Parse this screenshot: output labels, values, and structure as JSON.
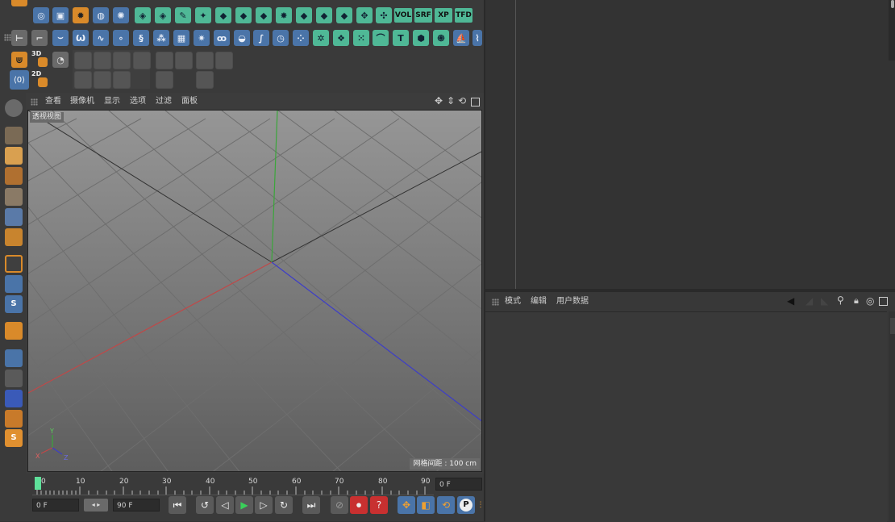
{
  "viewport": {
    "menu": [
      {
        "id": "view",
        "label": "查看"
      },
      {
        "id": "cameras",
        "label": "摄像机"
      },
      {
        "id": "display",
        "label": "显示"
      },
      {
        "id": "options",
        "label": "选项"
      },
      {
        "id": "filter",
        "label": "过滤"
      },
      {
        "id": "panel",
        "label": "面板"
      }
    ],
    "title": "透视视图",
    "grid_spacing": "网格间距 : 100 cm",
    "axis_labels": {
      "y": "Y",
      "x": "X",
      "z": "Z"
    }
  },
  "toolbar": {
    "text_buttons": [
      "VOL",
      "SRF",
      "XP",
      "TFD"
    ],
    "mode_3d": "3D",
    "mode_2d": "2D"
  },
  "timeline": {
    "ticks": [
      "0",
      "10",
      "20",
      "30",
      "40",
      "50",
      "60",
      "70",
      "80",
      "90"
    ],
    "current_frame": "0 F",
    "start_frame": "0 F",
    "end_frame": "90 F",
    "playhead": 0,
    "range": [
      0,
      90
    ]
  },
  "attributes": {
    "menu": [
      {
        "id": "mode",
        "label": "模式"
      },
      {
        "id": "edit",
        "label": "编辑"
      },
      {
        "id": "user_data",
        "label": "用户数据"
      }
    ]
  },
  "colors": {
    "x_axis": "#c04848",
    "y_axis": "#3aa63a",
    "z_axis": "#3d3dc8",
    "accent": "#4fb896"
  },
  "icons": {
    "playback": [
      "go-start-icon",
      "prev-key-icon",
      "prev-frame-icon",
      "play-icon",
      "next-frame-icon",
      "next-key-icon",
      "go-end-icon"
    ],
    "record": [
      "record-off-icon",
      "record-icon",
      "help-record-icon",
      "move-key-icon",
      "scale-key-icon",
      "rotate-key-icon",
      "param-key-icon"
    ]
  }
}
